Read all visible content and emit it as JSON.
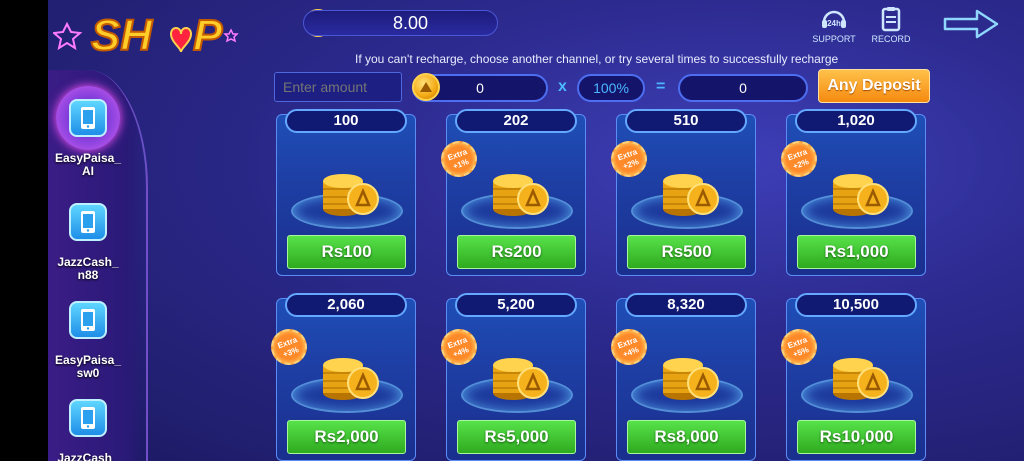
{
  "header": {
    "logo_text": "SHOP",
    "balance": "8.00",
    "support_label": "SUPPORT",
    "support_badge": "24h",
    "record_label": "RECORD"
  },
  "notice": "If you can't recharge, choose another channel, or try several times to successfully recharge",
  "amount_row": {
    "placeholder": "Enter amount",
    "coin_value": "0",
    "times": "x",
    "percent": "100%",
    "equals": "=",
    "result": "0",
    "any_deposit": "Any Deposit"
  },
  "channels": [
    {
      "label": "EasyPaisa_\nAI",
      "active": true
    },
    {
      "label": "JazzCash_\nn88",
      "active": false
    },
    {
      "label": "EasyPaisa_\nsw0",
      "active": false
    },
    {
      "label": "JazzCash_\nsw",
      "active": false
    }
  ],
  "packages": [
    {
      "coins": "100",
      "price": "Rs100",
      "extra": ""
    },
    {
      "coins": "202",
      "price": "Rs200",
      "extra": "Extra\n+1%"
    },
    {
      "coins": "510",
      "price": "Rs500",
      "extra": "Extra\n+2%"
    },
    {
      "coins": "1,020",
      "price": "Rs1,000",
      "extra": "Extra\n+2%"
    },
    {
      "coins": "2,060",
      "price": "Rs2,000",
      "extra": "Extra\n+3%"
    },
    {
      "coins": "5,200",
      "price": "Rs5,000",
      "extra": "Extra\n+4%"
    },
    {
      "coins": "8,320",
      "price": "Rs8,000",
      "extra": "Extra\n+4%"
    },
    {
      "coins": "10,500",
      "price": "Rs10,000",
      "extra": "Extra\n+5%"
    }
  ],
  "colors": {
    "accent_green": "#3fc42e",
    "accent_orange": "#f79a1c",
    "bg_blue": "#2c2a8e"
  }
}
